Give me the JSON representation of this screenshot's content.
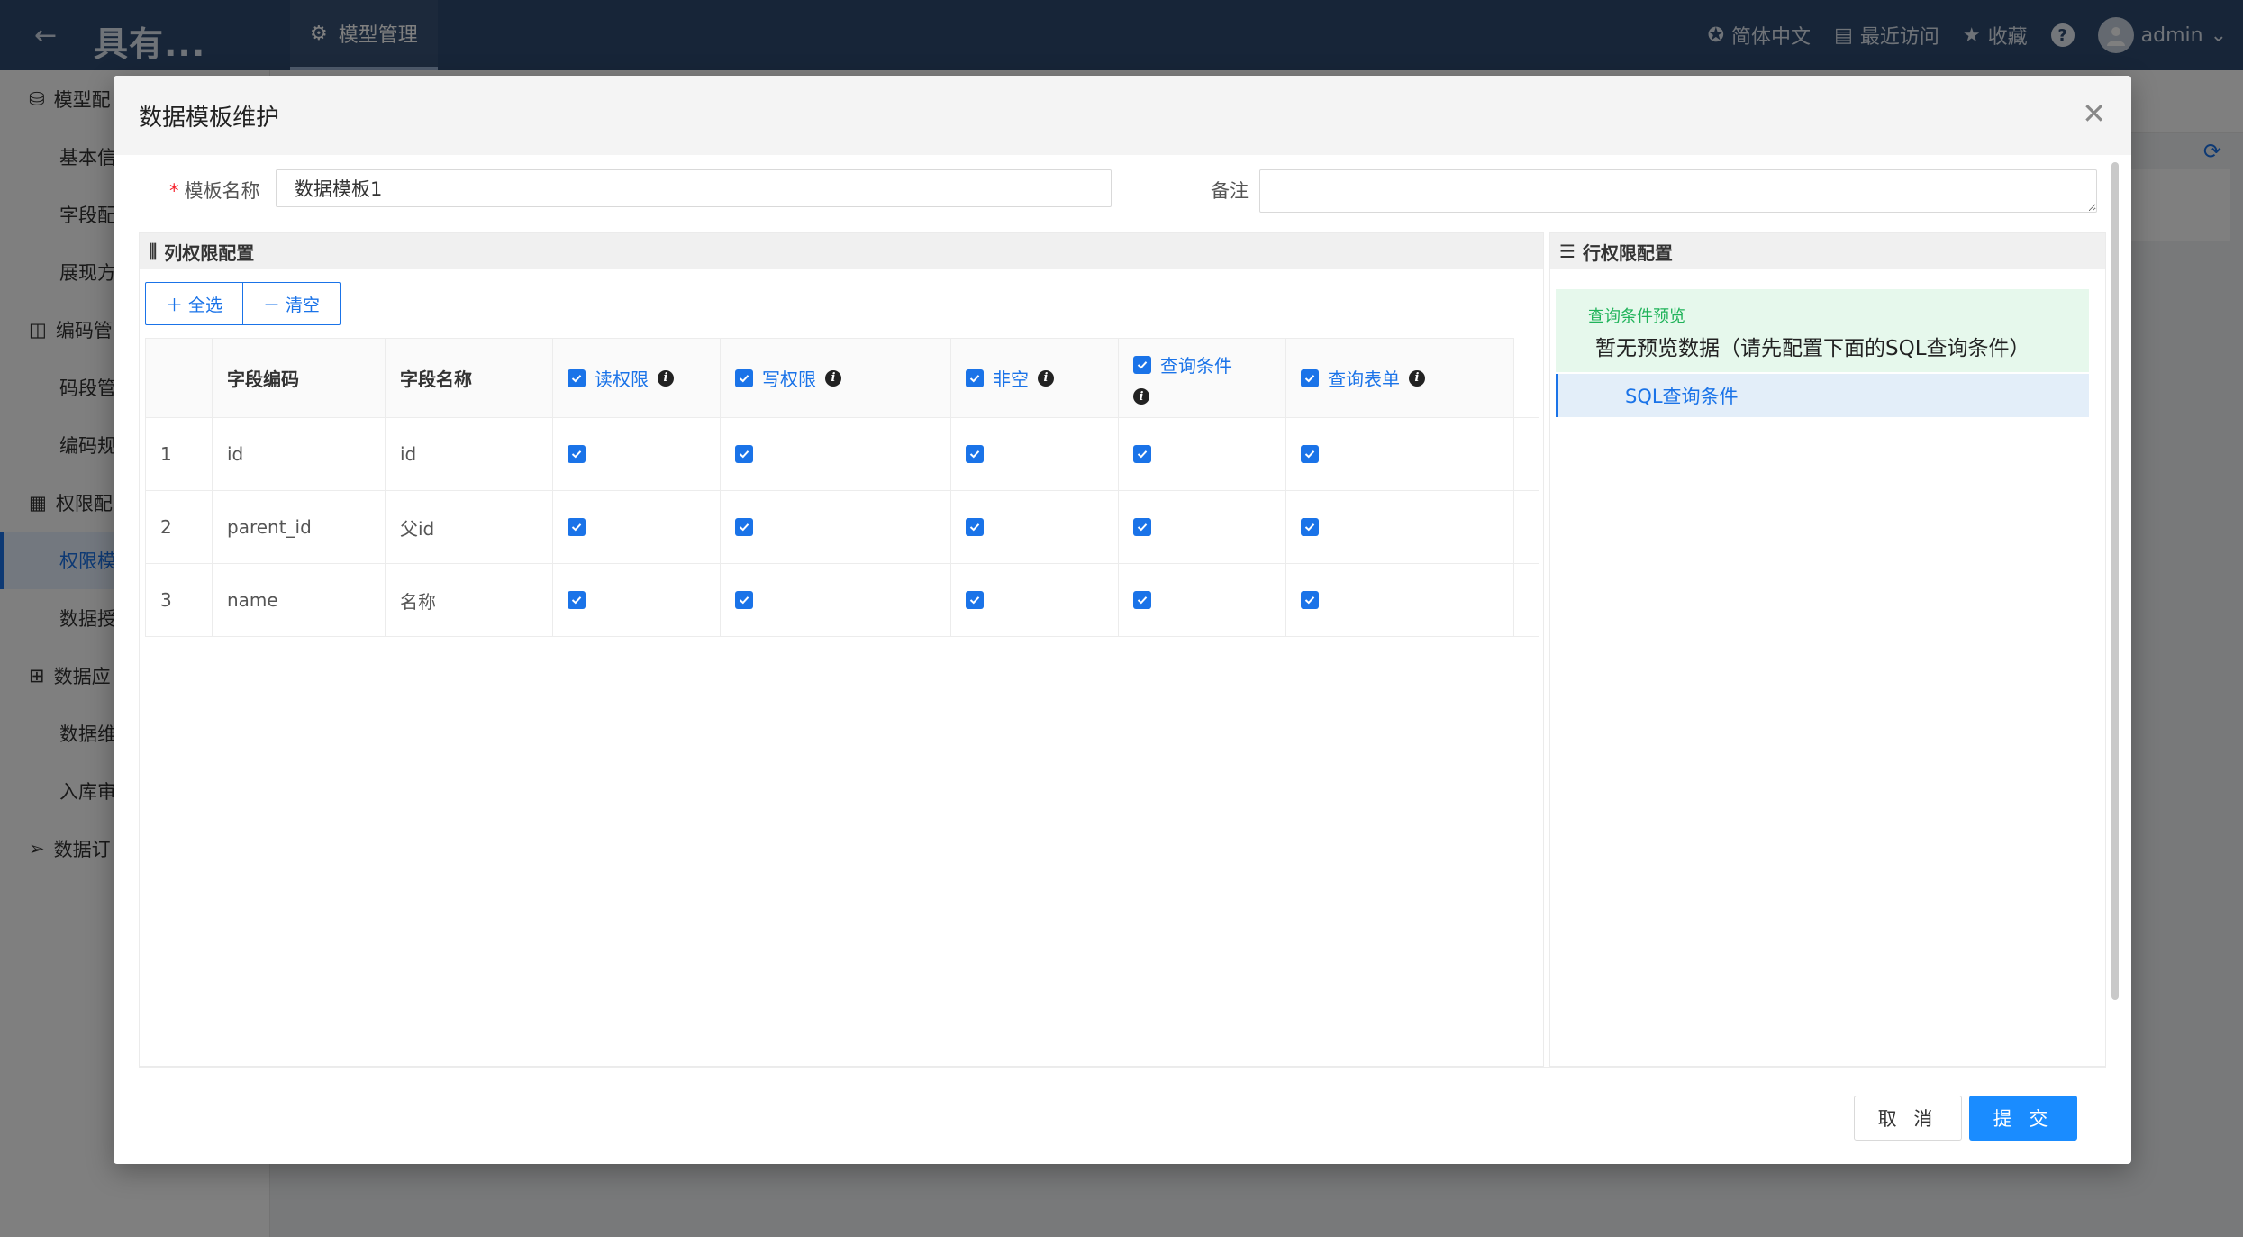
{
  "topbar": {
    "back_icon": "arrow-left-icon",
    "logo_text": "具有...",
    "active_tab": "模型管理",
    "language": "简体中文",
    "recent": "最近访问",
    "favorites": "收藏",
    "help": "?",
    "user": "admin"
  },
  "sidebar": {
    "items": [
      {
        "label": "模型配",
        "type": "group"
      },
      {
        "label": "基本信",
        "type": "sub"
      },
      {
        "label": "字段配",
        "type": "sub"
      },
      {
        "label": "展现方",
        "type": "sub"
      },
      {
        "label": "编码管",
        "type": "group"
      },
      {
        "label": "码段管",
        "type": "sub"
      },
      {
        "label": "编码规",
        "type": "sub"
      },
      {
        "label": "权限配",
        "type": "group"
      },
      {
        "label": "权限模",
        "type": "sub",
        "active": true
      },
      {
        "label": "数据授",
        "type": "sub"
      },
      {
        "label": "数据应",
        "type": "group"
      },
      {
        "label": "数据维",
        "type": "sub"
      },
      {
        "label": "入库审",
        "type": "sub"
      },
      {
        "label": "数据订",
        "type": "group"
      }
    ]
  },
  "modal": {
    "title": "数据模板维护",
    "name_label": "模板名称",
    "required_mark": "*",
    "name_value": "数据模板1",
    "remark_label": "备注",
    "remark_value": "",
    "column_section": {
      "title": "列权限配置",
      "select_all": "全选",
      "clear": "清空",
      "headers": {
        "field_code": "字段编码",
        "field_name": "字段名称",
        "read": "读权限",
        "write": "写权限",
        "not_null": "非空",
        "query_condition": "查询条件",
        "query_form": "查询表单"
      },
      "rows": [
        {
          "index": "1",
          "code": "id",
          "name": "id",
          "read": true,
          "write": true,
          "not_null": true,
          "query_condition": true,
          "query_form": true
        },
        {
          "index": "2",
          "code": "parent_id",
          "name": "父id",
          "read": true,
          "write": true,
          "not_null": true,
          "query_condition": true,
          "query_form": true
        },
        {
          "index": "3",
          "code": "name",
          "name": "名称",
          "read": true,
          "write": true,
          "not_null": true,
          "query_condition": true,
          "query_form": true
        }
      ]
    },
    "row_section": {
      "title": "行权限配置",
      "preview_label": "查询条件预览",
      "preview_text": "暂无预览数据（请先配置下面的SQL查询条件）",
      "sql_item": "SQL查询条件"
    },
    "cancel": "取 消",
    "submit": "提 交"
  },
  "colors": {
    "primary": "#1a73e8",
    "topbar": "#2e4a70",
    "success_text": "#20b35a",
    "preview_bg": "#e6f8ec"
  }
}
